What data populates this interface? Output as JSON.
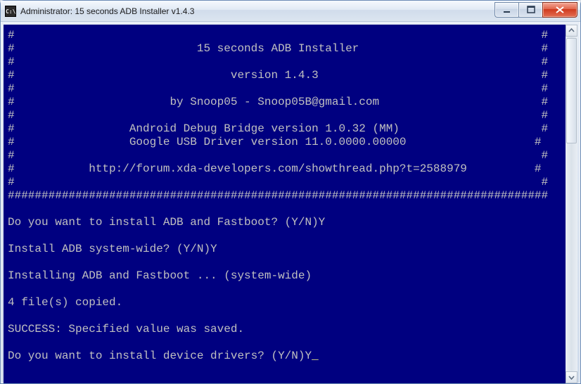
{
  "window": {
    "icon_label": "C:\\",
    "title": "Administrator:  15 seconds ADB Installer v1.4.3"
  },
  "console_text": "#                                                                              #\n#                           15 seconds ADB Installer                           #\n#                                                                              #\n#                                version 1.4.3                                 #\n#                                                                              #\n#                       by Snoop05 - Snoop05B@gmail.com                        #\n#                                                                              #\n#                 Android Debug Bridge version 1.0.32 (MM)                     #\n#                 Google USB Driver version 11.0.0000.00000                   #\n#                                                                              #\n#           http://forum.xda-developers.com/showthread.php?t=2588979          #\n#                                                                              #\n################################################################################\n\nDo you want to install ADB and Fastboot? (Y/N)Y\n\nInstall ADB system-wide? (Y/N)Y\n\nInstalling ADB and Fastboot ... (system-wide)\n\n4 file(s) copied.\n\nSUCCESS: Specified value was saved.\n\nDo you want to install device drivers? (Y/N)Y",
  "cursor": "_"
}
